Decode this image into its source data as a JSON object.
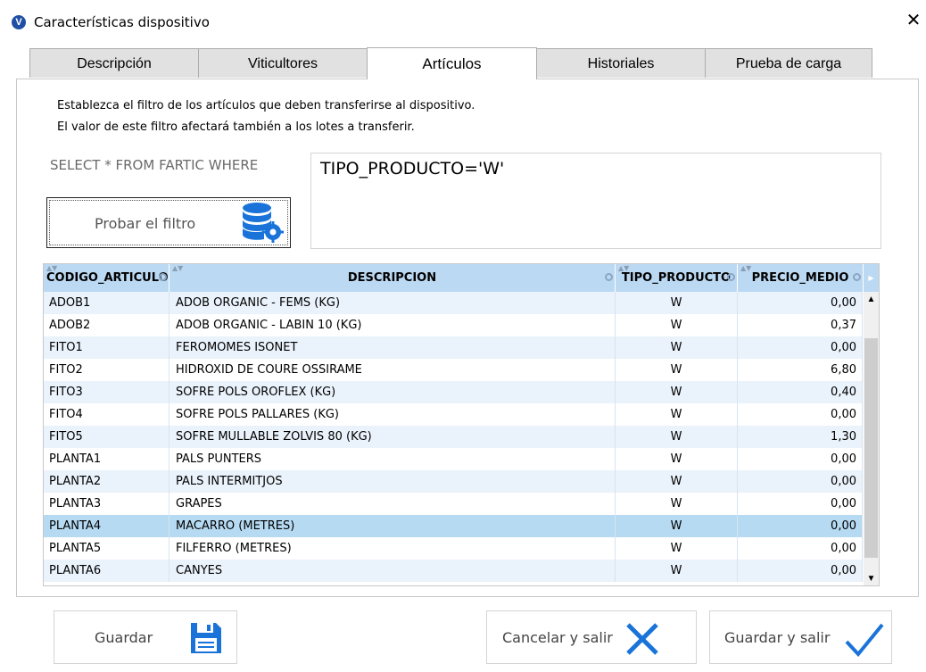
{
  "window": {
    "title": "Características dispositivo",
    "app_icon_glyph": "V",
    "close_glyph": "✕"
  },
  "tabs": [
    {
      "label": "Descripción",
      "active": false
    },
    {
      "label": "Viticultores",
      "active": false
    },
    {
      "label": "Artículos",
      "active": true
    },
    {
      "label": "Historiales",
      "active": false
    },
    {
      "label": "Prueba de carga",
      "active": false
    }
  ],
  "filter": {
    "line1": "Establezca el filtro de los artículos que deben transferirse al dispositivo.",
    "line2": "El valor de este filtro afectará también a los lotes a transferir.",
    "sql_prefix": "SELECT * FROM FARTIC WHERE",
    "value": "TIPO_PRODUCTO='W'",
    "test_button_label": "Probar el filtro"
  },
  "grid": {
    "columns": [
      "CODIGO_ARTICULO",
      "DESCRIPCION",
      "TIPO_PRODUCTO",
      "PRECIO_MEDIO"
    ],
    "rows": [
      [
        "ADOB1",
        "ADOB ORGANIC - FEMS (KG)",
        "W",
        "0,00"
      ],
      [
        "ADOB2",
        "ADOB ORGANIC - LABIN 10 (KG)",
        "W",
        "0,37"
      ],
      [
        "FITO1",
        "FEROMOMES ISONET",
        "W",
        "0,00"
      ],
      [
        "FITO2",
        "HIDROXID DE COURE OSSIRAME",
        "W",
        "6,80"
      ],
      [
        "FITO3",
        "SOFRE POLS OROFLEX (KG)",
        "W",
        "0,40"
      ],
      [
        "FITO4",
        "SOFRE POLS PALLARES (KG)",
        "W",
        "0,00"
      ],
      [
        "FITO5",
        "SOFRE MULLABLE ZOLVIS 80 (KG)",
        "W",
        "1,30"
      ],
      [
        "PLANTA1",
        "PALS PUNTERS",
        "W",
        "0,00"
      ],
      [
        "PLANTA2",
        "PALS INTERMITJOS",
        "W",
        "0,00"
      ],
      [
        "PLANTA3",
        "GRAPES",
        "W",
        "0,00"
      ],
      [
        "PLANTA4",
        "MACARRO (METRES)",
        "W",
        "0,00"
      ],
      [
        "PLANTA5",
        "FILFERRO (METRES)",
        "W",
        "0,00"
      ],
      [
        "PLANTA6",
        "CANYES",
        "W",
        "0,00"
      ]
    ],
    "selected_row": 10
  },
  "buttons": {
    "save": "Guardar",
    "cancel_exit": "Cancelar y salir",
    "save_exit": "Guardar y salir"
  },
  "colors": {
    "accent_blue": "#1a73d9",
    "header_bg": "#bcd9f3",
    "selected_row": "#b5daf2"
  }
}
